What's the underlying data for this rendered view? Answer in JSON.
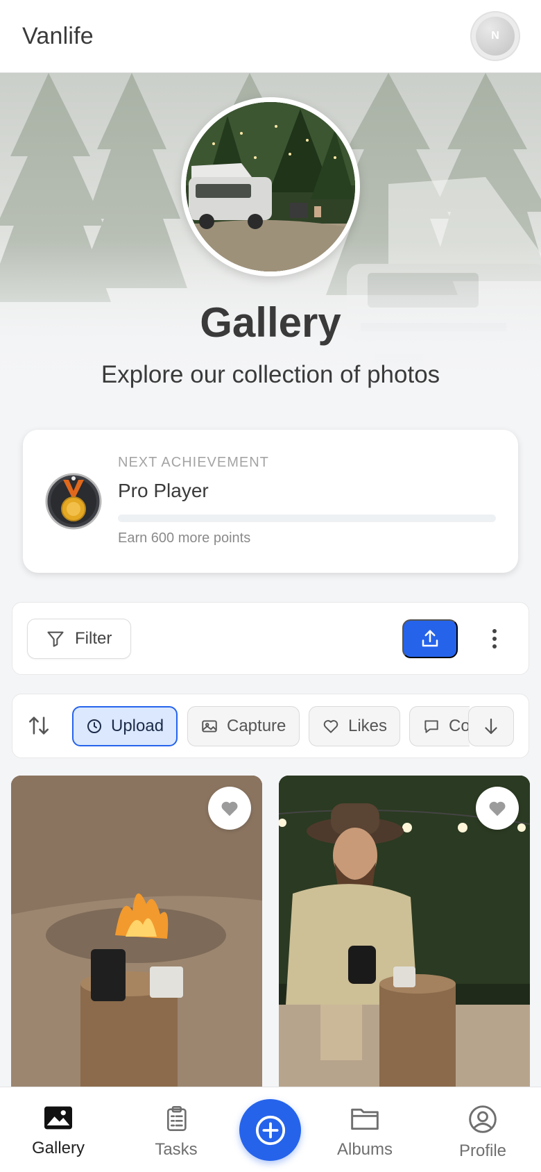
{
  "app": {
    "title": "Vanlife",
    "avatar_initial": "N"
  },
  "hero": {
    "title": "Gallery",
    "subtitle": "Explore our collection of photos"
  },
  "achievement": {
    "kicker": "NEXT ACHIEVEMENT",
    "name": "Pro Player",
    "progress": 0,
    "hint": "Earn 600 more points",
    "icon": "medal-icon"
  },
  "toolbar": {
    "filter_label": "Filter",
    "upload_icon": "upload-icon",
    "more_icon": "more-vertical-icon"
  },
  "sort": {
    "chips": [
      {
        "label": "Upload",
        "icon": "clock-icon",
        "active": true
      },
      {
        "label": "Capture",
        "icon": "image-icon",
        "active": false
      },
      {
        "label": "Likes",
        "icon": "heart-icon",
        "active": false
      },
      {
        "label": "Co",
        "icon": "comment-icon",
        "active": false
      }
    ]
  },
  "photos": [
    {
      "subject": "campfire-coffee"
    },
    {
      "subject": "man-pouring-coffee"
    }
  ],
  "nav": {
    "items": [
      {
        "label": "Gallery",
        "icon": "image-icon",
        "active": true
      },
      {
        "label": "Tasks",
        "icon": "clipboard-icon",
        "active": false
      },
      {
        "label": "Albums",
        "icon": "folder-icon",
        "active": false
      },
      {
        "label": "Profile",
        "icon": "user-circle-icon",
        "active": false
      }
    ],
    "fab_icon": "plus-circle-icon"
  },
  "colors": {
    "accent": "#2563eb",
    "chip_active_bg": "#dbe8fd"
  }
}
